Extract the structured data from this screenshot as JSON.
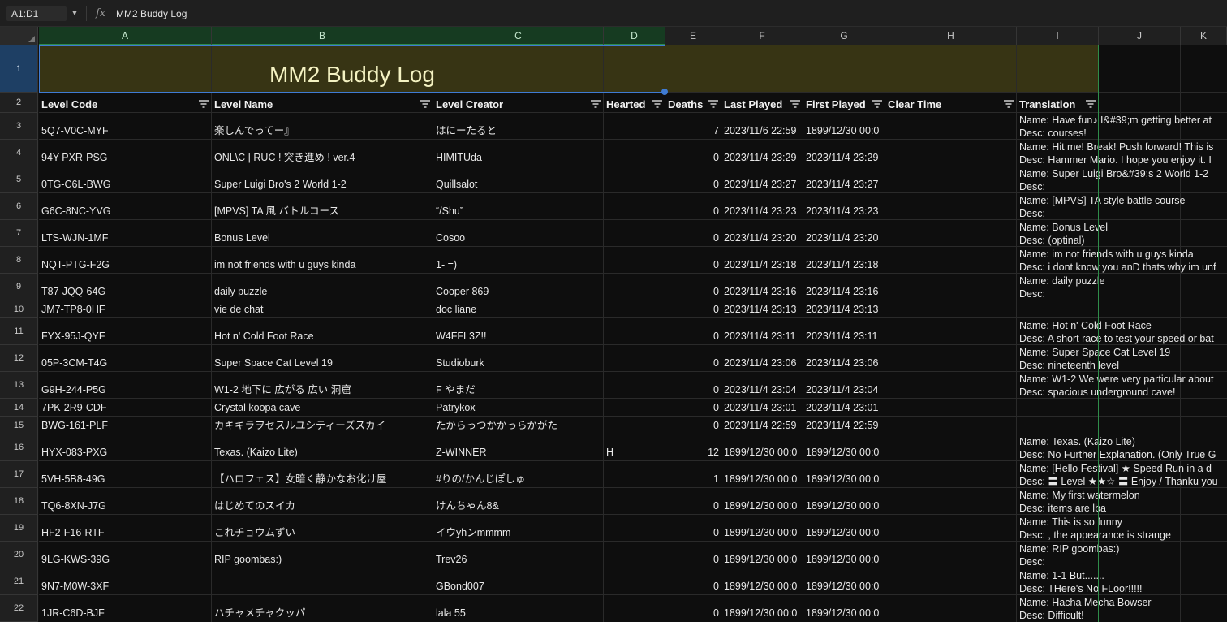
{
  "formula_bar": {
    "name_box": "A1:D1",
    "fx_label": "fx",
    "formula": "MM2 Buddy Log"
  },
  "columns": [
    "A",
    "B",
    "C",
    "D",
    "E",
    "F",
    "G",
    "H",
    "I",
    "J",
    "K"
  ],
  "title": "MM2 Buddy Log",
  "headers": {
    "level_code": "Level Code",
    "level_name": "Level Name",
    "level_creator": "Level Creator",
    "hearted": "Hearted",
    "deaths": "Deaths",
    "last_played": "Last Played",
    "first_played": "First Played",
    "clear_time": "Clear Time",
    "translation": "Translation"
  },
  "rows": [
    {
      "n": "3",
      "code": "5Q7-V0C-MYF",
      "name": "楽しんでってー』",
      "creator": "はにーたると",
      "hearted": "",
      "deaths": "7",
      "last": "2023/11/6 22:59",
      "first": "1899/12/30 00:0",
      "clear": "",
      "t1": "Name:  Have fun♪ I&#39;m getting better at",
      "t2": "Desc:  courses!"
    },
    {
      "n": "4",
      "code": "94Y-PXR-PSG",
      "name": "ONL\\C | RUC ! 突き進め ! ver.4",
      "creator": "HIMITUda",
      "hearted": "",
      "deaths": "0",
      "last": "2023/11/4 23:29",
      "first": "2023/11/4 23:29",
      "clear": "",
      "t1": "Name:  Hit me! Break! Push forward! This is",
      "t2": "Desc:  Hammer Mario. I hope you enjoy it. I"
    },
    {
      "n": "5",
      "code": "0TG-C6L-BWG",
      "name": "Super Luigi Bro's 2 World 1-2",
      "creator": "Quillsalot",
      "hearted": "",
      "deaths": "0",
      "last": "2023/11/4 23:27",
      "first": "2023/11/4 23:27",
      "clear": "",
      "t1": "Name:  Super Luigi Bro&#39;s 2 World 1-2",
      "t2": "Desc:"
    },
    {
      "n": "6",
      "code": "G6C-8NC-YVG",
      "name": "[MPVS] TA 風 バトルコース",
      "creator": "“/Shu”",
      "hearted": "",
      "deaths": "0",
      "last": "2023/11/4 23:23",
      "first": "2023/11/4 23:23",
      "clear": "",
      "t1": "Name:  [MPVS] TA style battle course",
      "t2": "Desc:"
    },
    {
      "n": "7",
      "code": "LTS-WJN-1MF",
      "name": "Bonus Level",
      "creator": "Cosoo",
      "hearted": "",
      "deaths": "0",
      "last": "2023/11/4 23:20",
      "first": "2023/11/4 23:20",
      "clear": "",
      "t1": "Name:  Bonus Level",
      "t2": "Desc: (optinal)"
    },
    {
      "n": "8",
      "code": "NQT-PTG-F2G",
      "name": "im not friends with u guys kinda",
      "creator": "1- =)",
      "hearted": "",
      "deaths": "0",
      "last": "2023/11/4 23:18",
      "first": "2023/11/4 23:18",
      "clear": "",
      "t1": "Name:  im not friends with u guys kinda",
      "t2": "Desc: i dont know you anD thats why im unf"
    },
    {
      "n": "9",
      "code": "T87-JQQ-64G",
      "name": "daily puzzle",
      "creator": "Cooper 869",
      "hearted": "",
      "deaths": "0",
      "last": "2023/11/4 23:16",
      "first": "2023/11/4 23:16",
      "clear": "",
      "t1": "Name:  daily puzzle",
      "t2": "Desc:"
    },
    {
      "n": "10",
      "code": "JM7-TP8-0HF",
      "name": "vie de chat",
      "creator": "doc liane",
      "hearted": "",
      "deaths": "0",
      "last": "2023/11/4 23:13",
      "first": "2023/11/4 23:13",
      "clear": "",
      "t1": "",
      "t2": ""
    },
    {
      "n": "11",
      "code": "FYX-95J-QYF",
      "name": "Hot n' Cold Foot Race",
      "creator": "W4FFL3Z!!",
      "hearted": "",
      "deaths": "0",
      "last": "2023/11/4 23:11",
      "first": "2023/11/4 23:11",
      "clear": "",
      "t1": "Name:  Hot n' Cold Foot Race",
      "t2": "Desc: A short race to test your speed or bat"
    },
    {
      "n": "12",
      "code": "05P-3CM-T4G",
      "name": "Super Space Cat Level 19",
      "creator": "Studioburk",
      "hearted": "",
      "deaths": "0",
      "last": "2023/11/4 23:06",
      "first": "2023/11/4 23:06",
      "clear": "",
      "t1": "Name:  Super Space Cat Level 19",
      "t2": "Desc: nineteenth level"
    },
    {
      "n": "13",
      "code": "G9H-244-P5G",
      "name": "W1-2 地下に 広がる 広い 洞窟",
      "creator": "F やまだ",
      "hearted": "",
      "deaths": "0",
      "last": "2023/11/4 23:04",
      "first": "2023/11/4 23:04",
      "clear": "",
      "t1": "Name:  W1-2 We were very particular about",
      "t2": "Desc:  spacious underground cave!"
    },
    {
      "n": "14",
      "code": "7PK-2R9-CDF",
      "name": "Crystal koopa cave",
      "creator": "Patrykox",
      "hearted": "",
      "deaths": "0",
      "last": "2023/11/4 23:01",
      "first": "2023/11/4 23:01",
      "clear": "",
      "t1": "",
      "t2": ""
    },
    {
      "n": "15",
      "code": "BWG-161-PLF",
      "name": "カキキラヲセスルユシティーズスカイ",
      "creator": "たからっつかかっらかがた",
      "hearted": "",
      "deaths": "0",
      "last": "2023/11/4 22:59",
      "first": "2023/11/4 22:59",
      "clear": "",
      "t1": "",
      "t2": ""
    },
    {
      "n": "16",
      "code": "HYX-083-PXG",
      "name": "Texas. (Kaizo Lite)",
      "creator": "Z-WINNER",
      "hearted": "H",
      "deaths": "12",
      "last": "1899/12/30 00:0",
      "first": "1899/12/30 00:0",
      "clear": "",
      "t1": "Name:  Texas. (Kaizo Lite)",
      "t2": "Desc: No Further Explanation. (Only True G"
    },
    {
      "n": "17",
      "code": "5VH-5B8-49G",
      "name": "【ハロフェス】女暗く静かなお化け屋",
      "creator": "#りの/かんじぽしゅ",
      "hearted": "",
      "deaths": "1",
      "last": "1899/12/30 00:0",
      "first": "1899/12/30 00:0",
      "clear": "",
      "t1": "Name:  [Hello Festival] ★ Speed Run in a d",
      "t2": "Desc: 〓 Level ★★☆ 〓 Enjoy / Thanku you"
    },
    {
      "n": "18",
      "code": "TQ6-8XN-J7G",
      "name": "はじめてのスイカ",
      "creator": "けんちゃん8&",
      "hearted": "",
      "deaths": "0",
      "last": "1899/12/30 00:0",
      "first": "1899/12/30 00:0",
      "clear": "",
      "t1": "Name:  My first watermelon",
      "t2": "Desc:  items are lba"
    },
    {
      "n": "19",
      "code": "HF2-F16-RTF",
      "name": "これチョウムずい",
      "creator": "イウyhンmmmm",
      "hearted": "",
      "deaths": "0",
      "last": "1899/12/30 00:0",
      "first": "1899/12/30 00:0",
      "clear": "",
      "t1": "Name:  This is so funny",
      "t2": "Desc: , the appearance is strange"
    },
    {
      "n": "20",
      "code": "9LG-KWS-39G",
      "name": "RIP goombas:)",
      "creator": "Trev26",
      "hearted": "",
      "deaths": "0",
      "last": "1899/12/30 00:0",
      "first": "1899/12/30 00:0",
      "clear": "",
      "t1": "Name:  RIP goombas:)",
      "t2": "Desc:"
    },
    {
      "n": "21",
      "code": "9N7-M0W-3XF",
      "name": "",
      "creator": "GBond007",
      "hearted": "",
      "deaths": "0",
      "last": "1899/12/30 00:0",
      "first": "1899/12/30 00:0",
      "clear": "",
      "t1": "Name:  1-1 But.......",
      "t2": "Desc: THere's No FLoor!!!!!"
    },
    {
      "n": "22",
      "code": "1JR-C6D-BJF",
      "name": "ハチャメチャクッパ",
      "creator": "lala 55",
      "hearted": "",
      "deaths": "0",
      "last": "1899/12/30 00:0",
      "first": "1899/12/30 00:0",
      "clear": "",
      "t1": "Name:  Hacha Mecha Bowser",
      "t2": "Desc:  Difficult!"
    }
  ]
}
